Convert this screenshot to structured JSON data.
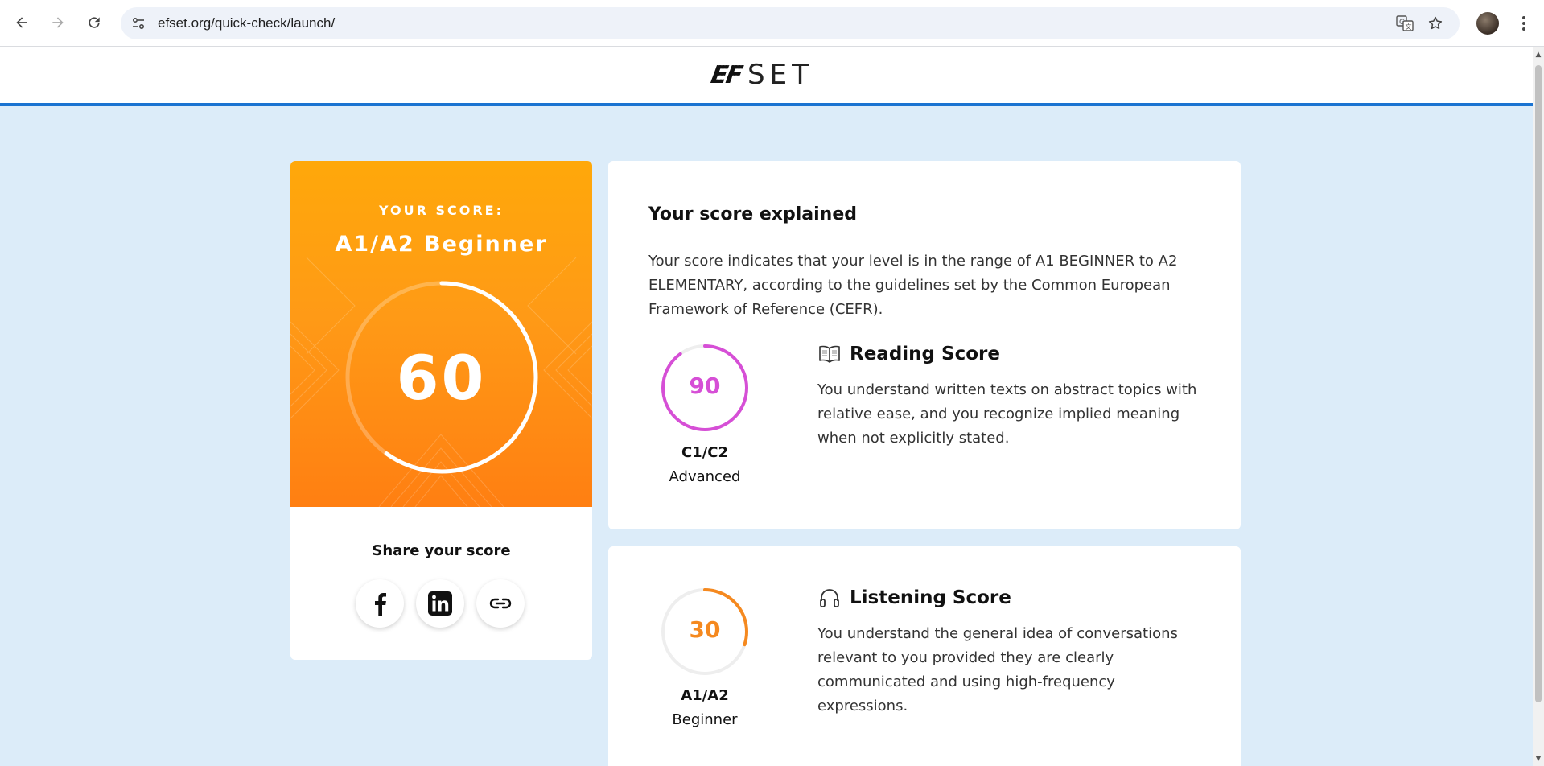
{
  "browser": {
    "url": "efset.org/quick-check/launch/"
  },
  "site": {
    "logo_ef": "EF",
    "logo_set": "SET"
  },
  "score_card": {
    "label": "YOUR SCORE:",
    "level": "A1/A2 Beginner",
    "score": "60",
    "score_fraction": 0.6,
    "share_title": "Share your score",
    "share_buttons": [
      "facebook",
      "linkedin",
      "copy-link"
    ]
  },
  "explanation": {
    "title": "Your score explained",
    "text": "Your score indicates that your level is in the range of A1 BEGINNER to A2 ELEMENTARY, according to the guidelines set by the Common European Framework of Reference (CEFR)."
  },
  "reading": {
    "score": "90",
    "score_fraction": 0.9,
    "color": "#d64fd6",
    "level_code": "C1/C2",
    "level_name": "Advanced",
    "title": "Reading Score",
    "icon": "book-icon",
    "text": "You understand written texts on abstract topics with relative ease, and you recognize implied meaning when not explicitly stated."
  },
  "listening": {
    "score": "30",
    "score_fraction": 0.3,
    "color": "#f5891f",
    "level_code": "A1/A2",
    "level_name": "Beginner",
    "title": "Listening Score",
    "icon": "headphones-icon",
    "text": "You understand the general idea of conversations relevant to you provided they are clearly communicated and using high-frequency expressions."
  }
}
